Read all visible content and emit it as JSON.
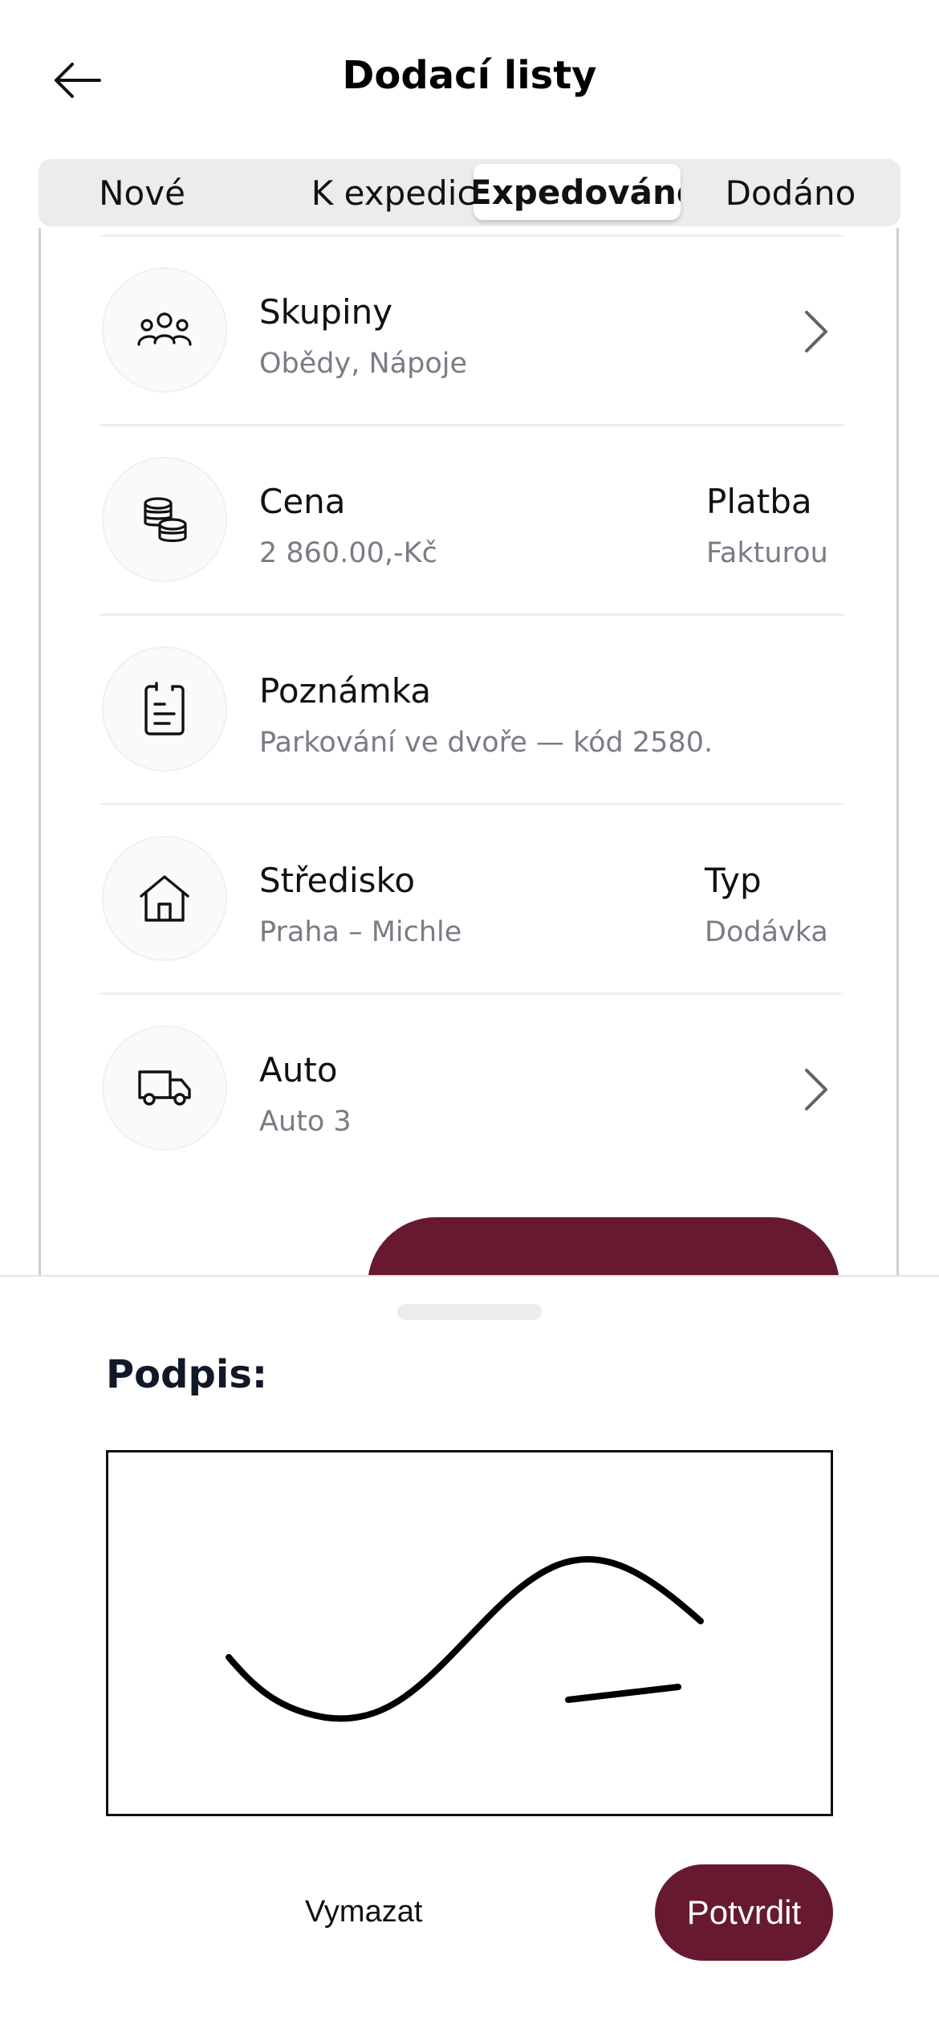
{
  "header": {
    "title": "Dodací listy"
  },
  "tabs": [
    {
      "label": "Nové",
      "active": false
    },
    {
      "label": "K expedici",
      "active": false
    },
    {
      "label": "Expedováno",
      "active": true
    },
    {
      "label": "Dodáno",
      "active": false
    }
  ],
  "details": {
    "groups": {
      "label": "Skupiny",
      "value": "Obědy, Nápoje"
    },
    "price": {
      "label": "Cena",
      "value": "2 860.00,-Kč"
    },
    "payment": {
      "label": "Platba",
      "value": "Fakturou"
    },
    "note": {
      "label": "Poznámka",
      "value": "Parkování ve dvoře — kód 2580."
    },
    "center": {
      "label": "Středisko",
      "value": "Praha – Michle"
    },
    "type": {
      "label": "Typ",
      "value": "Dodávka"
    },
    "car": {
      "label": "Auto",
      "value": "Auto 3"
    }
  },
  "colors": {
    "brand": "#671a2f",
    "muted_text": "#7a7c85"
  },
  "signature_sheet": {
    "title": "Podpis:",
    "clear_label": "Vymazat",
    "confirm_label": "Potvrdit"
  }
}
